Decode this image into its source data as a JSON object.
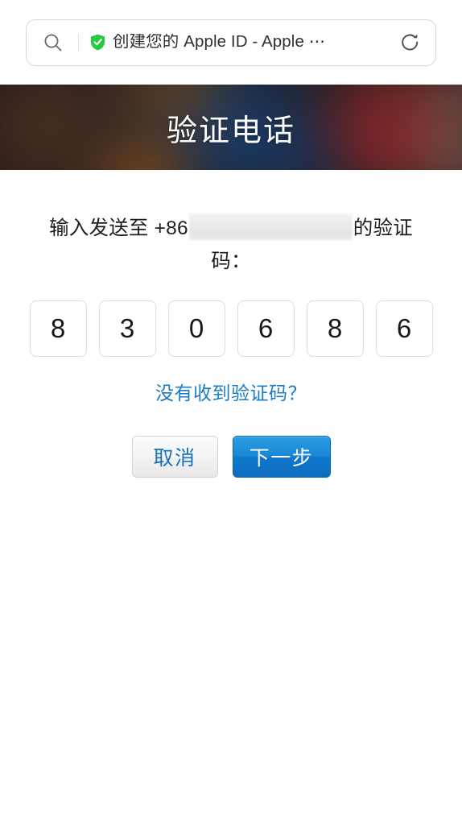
{
  "browser": {
    "search_icon": "search-icon",
    "shield_icon": "shield-secure-icon",
    "reload_icon": "reload-icon",
    "page_title": "创建您的 Apple ID - Apple ⋯"
  },
  "hero": {
    "title": "验证电话"
  },
  "content": {
    "instruction_prefix": "输入发送至 +86",
    "phone_redacted": "",
    "instruction_suffix": "的验证码：",
    "code_digits": [
      "8",
      "3",
      "0",
      "6",
      "8",
      "6"
    ],
    "resend_link": "没有收到验证码？"
  },
  "actions": {
    "cancel_label": "取消",
    "next_label": "下一步"
  },
  "colors": {
    "link_blue": "#1a7bc4",
    "primary_button": "#1a87d6",
    "shield_green": "#28c43c",
    "text_dark": "#1d1d1f"
  }
}
